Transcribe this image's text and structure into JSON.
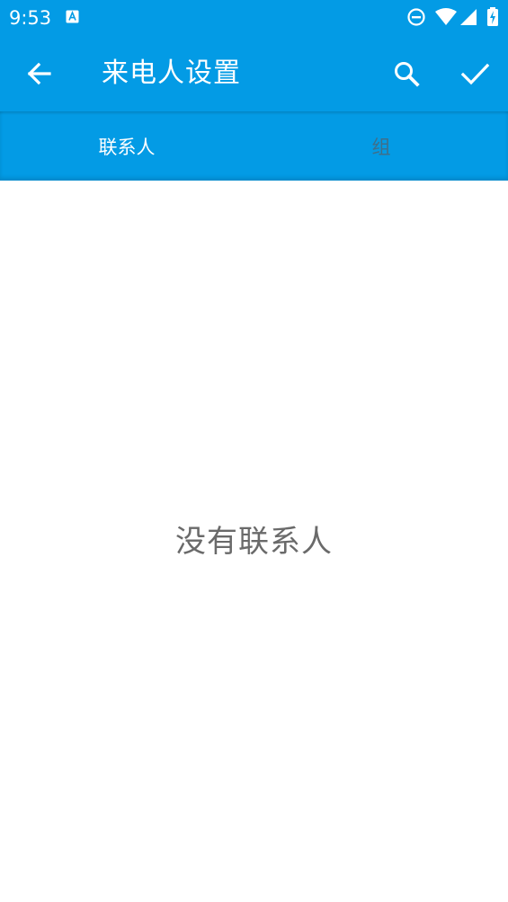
{
  "status_bar": {
    "time": "9:53",
    "icons": [
      "app-notification-icon",
      "do-not-disturb-icon",
      "wifi-icon",
      "signal-icon",
      "battery-charging-icon"
    ]
  },
  "app_bar": {
    "title": "来电人设置",
    "back_icon": "arrow-back-icon",
    "search_icon": "search-icon",
    "confirm_icon": "check-icon",
    "background_color": "#039be5"
  },
  "tabs": [
    {
      "label": "联系人",
      "selected": true
    },
    {
      "label": "组",
      "selected": false
    }
  ],
  "content": {
    "empty_message": "没有联系人"
  }
}
